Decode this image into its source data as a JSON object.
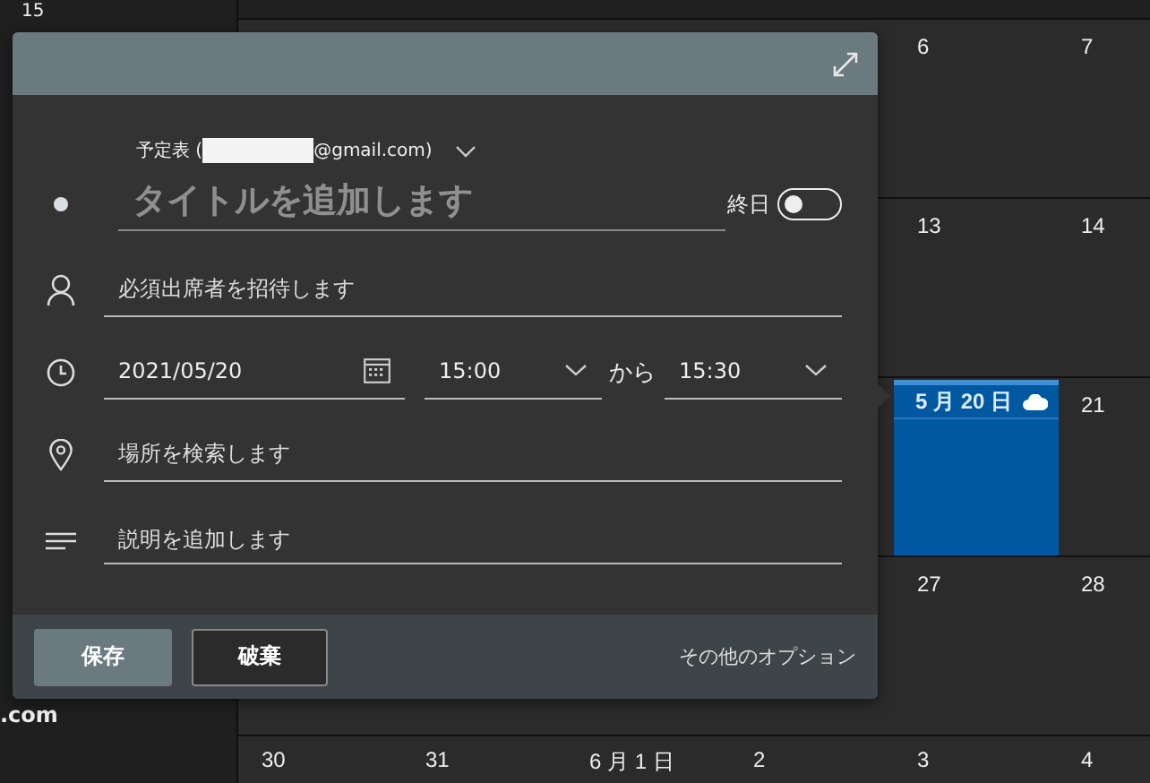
{
  "sidebar": {
    "texts": [
      "15",
      ".com"
    ]
  },
  "calendar": {
    "rows": [
      {
        "cells": [
          {},
          {},
          {},
          {},
          {
            "day": "6"
          },
          {
            "day": "7"
          }
        ]
      },
      {
        "cells": [
          {},
          {},
          {},
          {},
          {
            "day": "13"
          },
          {
            "day": "14"
          }
        ]
      },
      {
        "cells": [
          {},
          {},
          {},
          {},
          {
            "day": "5 月 20 日",
            "selected": true
          },
          {
            "day": "21"
          }
        ]
      },
      {
        "cells": [
          {},
          {},
          {},
          {},
          {
            "day": "27"
          },
          {
            "day": "28"
          }
        ]
      },
      {
        "cells": [
          {
            "day": "30"
          },
          {
            "day": "31"
          },
          {
            "day": "6 月 1 日"
          },
          {
            "day": "2"
          },
          {
            "day": "3"
          },
          {
            "day": "4"
          }
        ]
      }
    ]
  },
  "dialog": {
    "calendar_prefix": "予定表 (",
    "calendar_suffix": "@gmail.com)",
    "title": {
      "placeholder": "タイトルを追加します"
    },
    "all_day": {
      "label": "終日",
      "on": false
    },
    "attendees": {
      "placeholder": "必須出席者を招待します"
    },
    "date": "2021/05/20",
    "start": "15:00",
    "separator": "から",
    "end": "15:30",
    "location": {
      "placeholder": "場所を検索します"
    },
    "description": {
      "placeholder": "説明を追加します"
    },
    "buttons": [
      "保存",
      "破棄"
    ],
    "more_options": "その他のオプション"
  }
}
